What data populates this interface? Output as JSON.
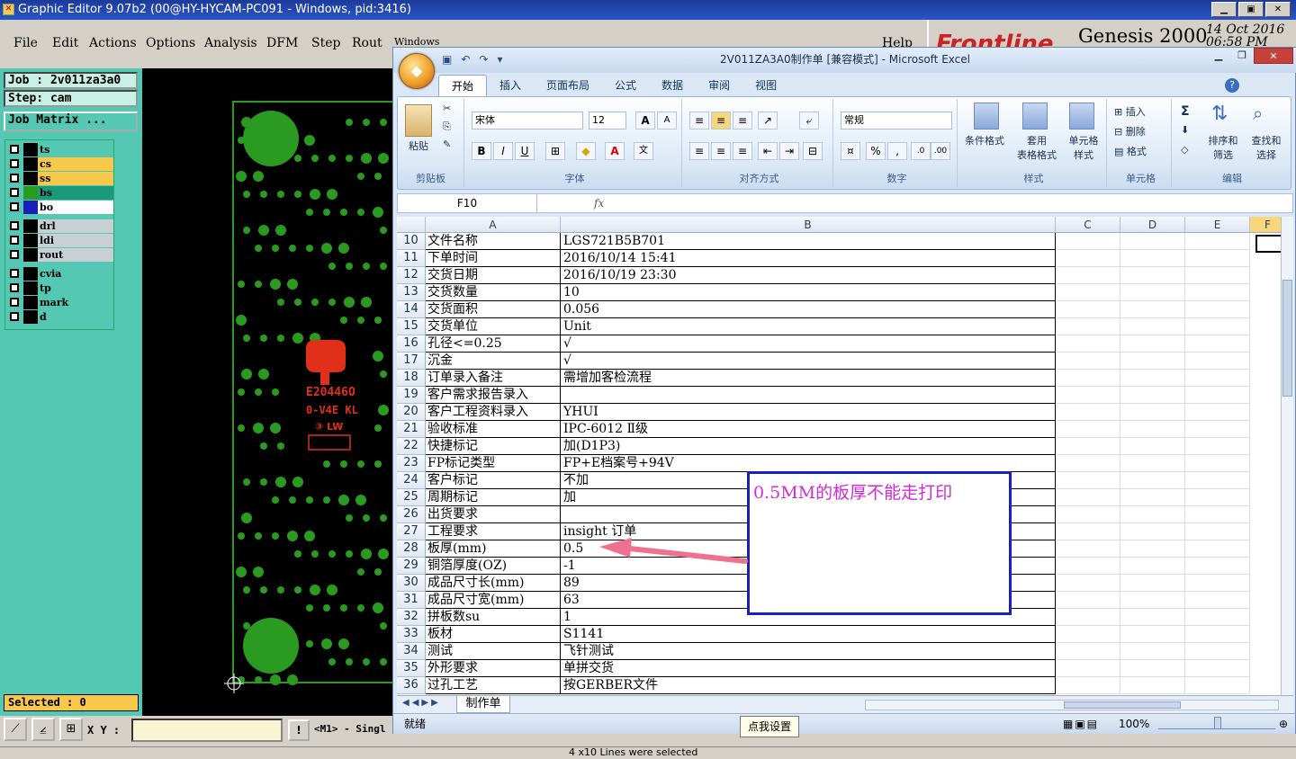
{
  "genesis": {
    "title": "Graphic Editor 9.07b2 (00@HY-HYCAM-PC091 - Windows, pid:3416)",
    "menu": [
      "File",
      "Edit",
      "Actions",
      "Options",
      "Analysis",
      "DFM",
      "Step",
      "Rout",
      "Windows",
      "Help"
    ],
    "brand": {
      "logo": "Frontline",
      "product": "Genesis 2000",
      "date": "14 Oct 2016",
      "time": "06:58 PM"
    },
    "job_label": "Job : 2v011za3a0",
    "step_label": "Step: cam",
    "job_matrix_button": "Job Matrix ...",
    "layers": [
      {
        "name": "ts",
        "color": "#1a9a7a",
        "bg": "#55c8b4"
      },
      {
        "name": "cs",
        "color": "#f8c84a",
        "bg": "#f8c84a"
      },
      {
        "name": "ss",
        "color": "#f8c84a",
        "bg": "#f8c84a"
      },
      {
        "name": "bs",
        "color": "#2a9a20",
        "bg": "#1a9a7a"
      },
      {
        "name": "bo",
        "color": "#e0301a",
        "bg": "#ffffff"
      },
      {
        "name": "drl",
        "color": "#000000",
        "bg": "#c8d0d4"
      },
      {
        "name": "ldi",
        "color": "#000000",
        "bg": "#c8d0d4"
      },
      {
        "name": "rout",
        "color": "#000000",
        "bg": "#c8d0d4"
      },
      {
        "name": "cvia",
        "color": "#000000",
        "bg": "#55c8b4"
      },
      {
        "name": "tp",
        "color": "#000000",
        "bg": "#55c8b4"
      },
      {
        "name": "mark",
        "color": "#000000",
        "bg": "#55c8b4"
      },
      {
        "name": "d",
        "color": "#000000",
        "bg": "#55c8b4"
      }
    ],
    "selected_label": "Selected : 0",
    "xy_label": "X Y :",
    "mode_label": "<M1> - Singl",
    "bottom_status": "4 x10 Lines were selected"
  },
  "excel": {
    "title": "2V011ZA3A0制作单 [兼容模式] - Microsoft Excel",
    "tabs": [
      "开始",
      "插入",
      "页面布局",
      "公式",
      "数据",
      "审阅",
      "视图"
    ],
    "active_tab": "开始",
    "ribbon": {
      "paste": "粘贴",
      "clipboard_group": "剪贴板",
      "font_name": "宋体",
      "font_size": "12",
      "font_group": "字体",
      "align_group": "对齐方式",
      "number_format": "常规",
      "number_group": "数字",
      "cond_format": "条件格式",
      "table_format": "套用\n表格格式",
      "cell_style": "单元格\n样式",
      "styles_group": "样式",
      "insert": "插入",
      "delete": "删除",
      "format": "格式",
      "cells_group": "单元格",
      "sort_filter": "排序和\n筛选",
      "find_select": "查找和\n选择",
      "edit_group": "编辑"
    },
    "name_box": "F10",
    "fx": "fx",
    "columns": [
      "A",
      "B",
      "C",
      "D",
      "E",
      "F"
    ],
    "rows": [
      {
        "num": "10",
        "a": "文件名称",
        "b": "LGS721B5B701"
      },
      {
        "num": "11",
        "a": "下单时间",
        "b": "2016/10/14 15:41"
      },
      {
        "num": "12",
        "a": "交货日期",
        "b": "2016/10/19 23:30"
      },
      {
        "num": "13",
        "a": "交货数量",
        "b": "10"
      },
      {
        "num": "14",
        "a": "交货面积",
        "b": "0.056"
      },
      {
        "num": "15",
        "a": "交货单位",
        "b": "Unit"
      },
      {
        "num": "16",
        "a": "孔径<=0.25",
        "b": "√"
      },
      {
        "num": "17",
        "a": "沉金",
        "b": "√"
      },
      {
        "num": "18",
        "a": "订单录入备注",
        "b": "需增加客检流程"
      },
      {
        "num": "19",
        "a": "客户需求报告录入",
        "b": ""
      },
      {
        "num": "20",
        "a": "客户工程资料录入",
        "b": "YHUI"
      },
      {
        "num": "21",
        "a": "验收标准",
        "b": "IPC-6012 Ⅱ级"
      },
      {
        "num": "22",
        "a": "快捷标记",
        "b": "加(D1P3)"
      },
      {
        "num": "23",
        "a": "FP标记类型",
        "b": "FP+E档案号+94V"
      },
      {
        "num": "24",
        "a": "客户标记",
        "b": "不加"
      },
      {
        "num": "25",
        "a": "周期标记",
        "b": "加"
      },
      {
        "num": "26",
        "a": "出货要求",
        "b": ""
      },
      {
        "num": "27",
        "a": "工程要求",
        "b": "insight 订单"
      },
      {
        "num": "28",
        "a": "板厚(mm)",
        "b": "0.5"
      },
      {
        "num": "29",
        "a": "铜箔厚度(OZ)",
        "b": "-1"
      },
      {
        "num": "30",
        "a": "成品尺寸长(mm)",
        "b": "89"
      },
      {
        "num": "31",
        "a": "成品尺寸宽(mm)",
        "b": "63"
      },
      {
        "num": "32",
        "a": "拼板数su",
        "b": "1"
      },
      {
        "num": "33",
        "a": "板材",
        "b": "S1141"
      },
      {
        "num": "34",
        "a": "测试",
        "b": "飞针测试"
      },
      {
        "num": "35",
        "a": "外形要求",
        "b": "单拼交货"
      },
      {
        "num": "36",
        "a": "过孔工艺",
        "b": "按GERBER文件"
      }
    ],
    "annotation": "0.5MM的板厚不能走打印",
    "sheet_tab": "制作单",
    "status_ready": "就绪",
    "zoom": "100%"
  },
  "tooltip": "点我设置"
}
